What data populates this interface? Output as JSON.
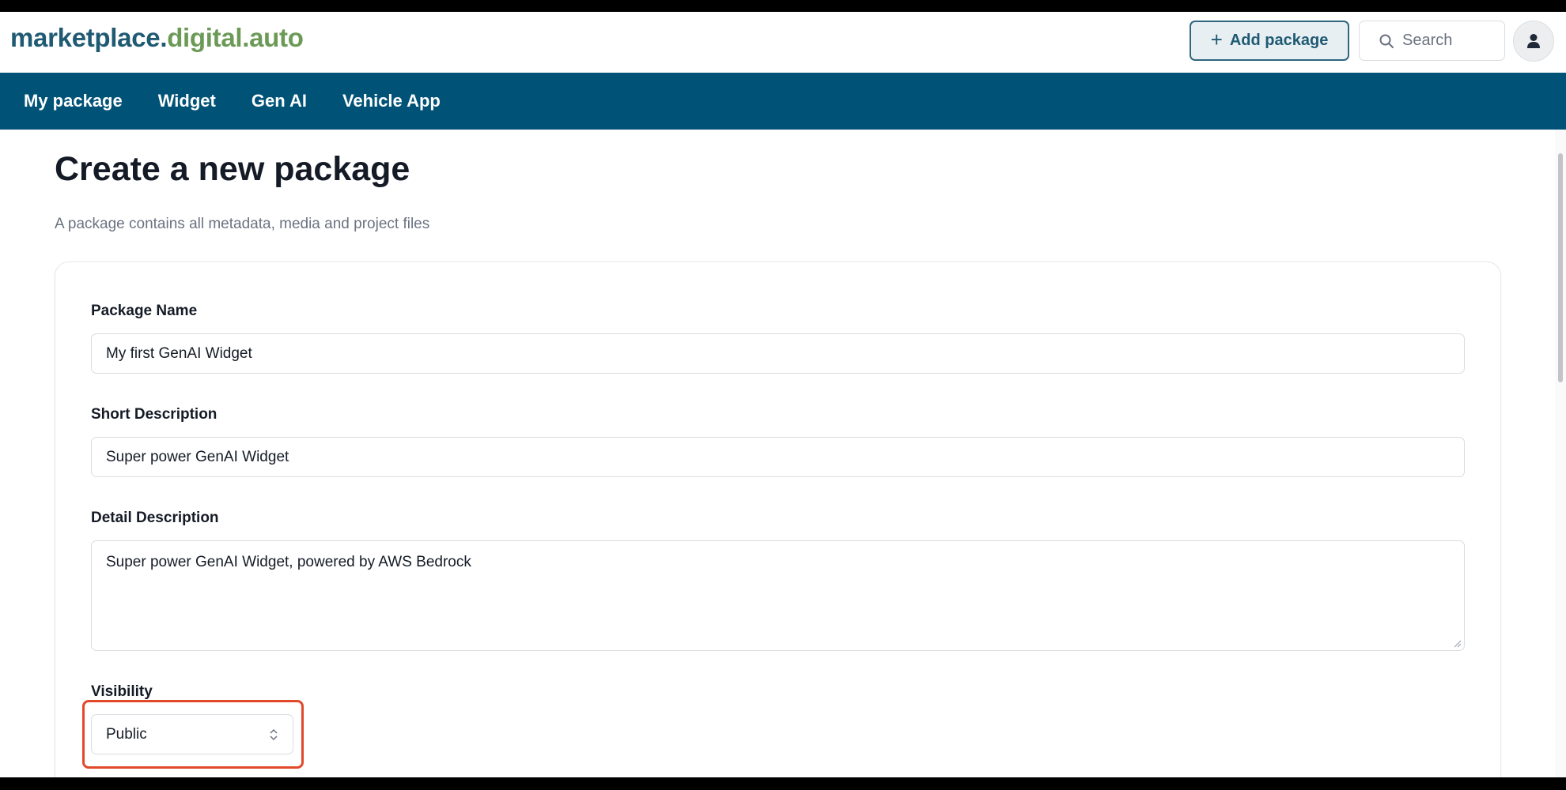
{
  "header": {
    "logo_part1": "marketplace.",
    "logo_part2": "digital.auto",
    "add_package_label": "Add package",
    "search_placeholder": "Search"
  },
  "nav": {
    "items": [
      {
        "label": "My package"
      },
      {
        "label": "Widget"
      },
      {
        "label": "Gen AI"
      },
      {
        "label": "Vehicle App"
      }
    ]
  },
  "page": {
    "title": "Create a new package",
    "subtitle": "A package contains all metadata, media and project files"
  },
  "form": {
    "package_name": {
      "label": "Package Name",
      "value": "My first GenAI Widget"
    },
    "short_description": {
      "label": "Short Description",
      "value": "Super power GenAI Widget"
    },
    "detail_description": {
      "label": "Detail Description",
      "value": "Super power GenAI Widget, powered by AWS Bedrock"
    },
    "visibility": {
      "label": "Visibility",
      "value": "Public"
    }
  },
  "colors": {
    "brand_dark": "#1f5a73",
    "brand_green": "#6b9a56",
    "nav_bg": "#005277",
    "highlight": "#e2492b"
  }
}
